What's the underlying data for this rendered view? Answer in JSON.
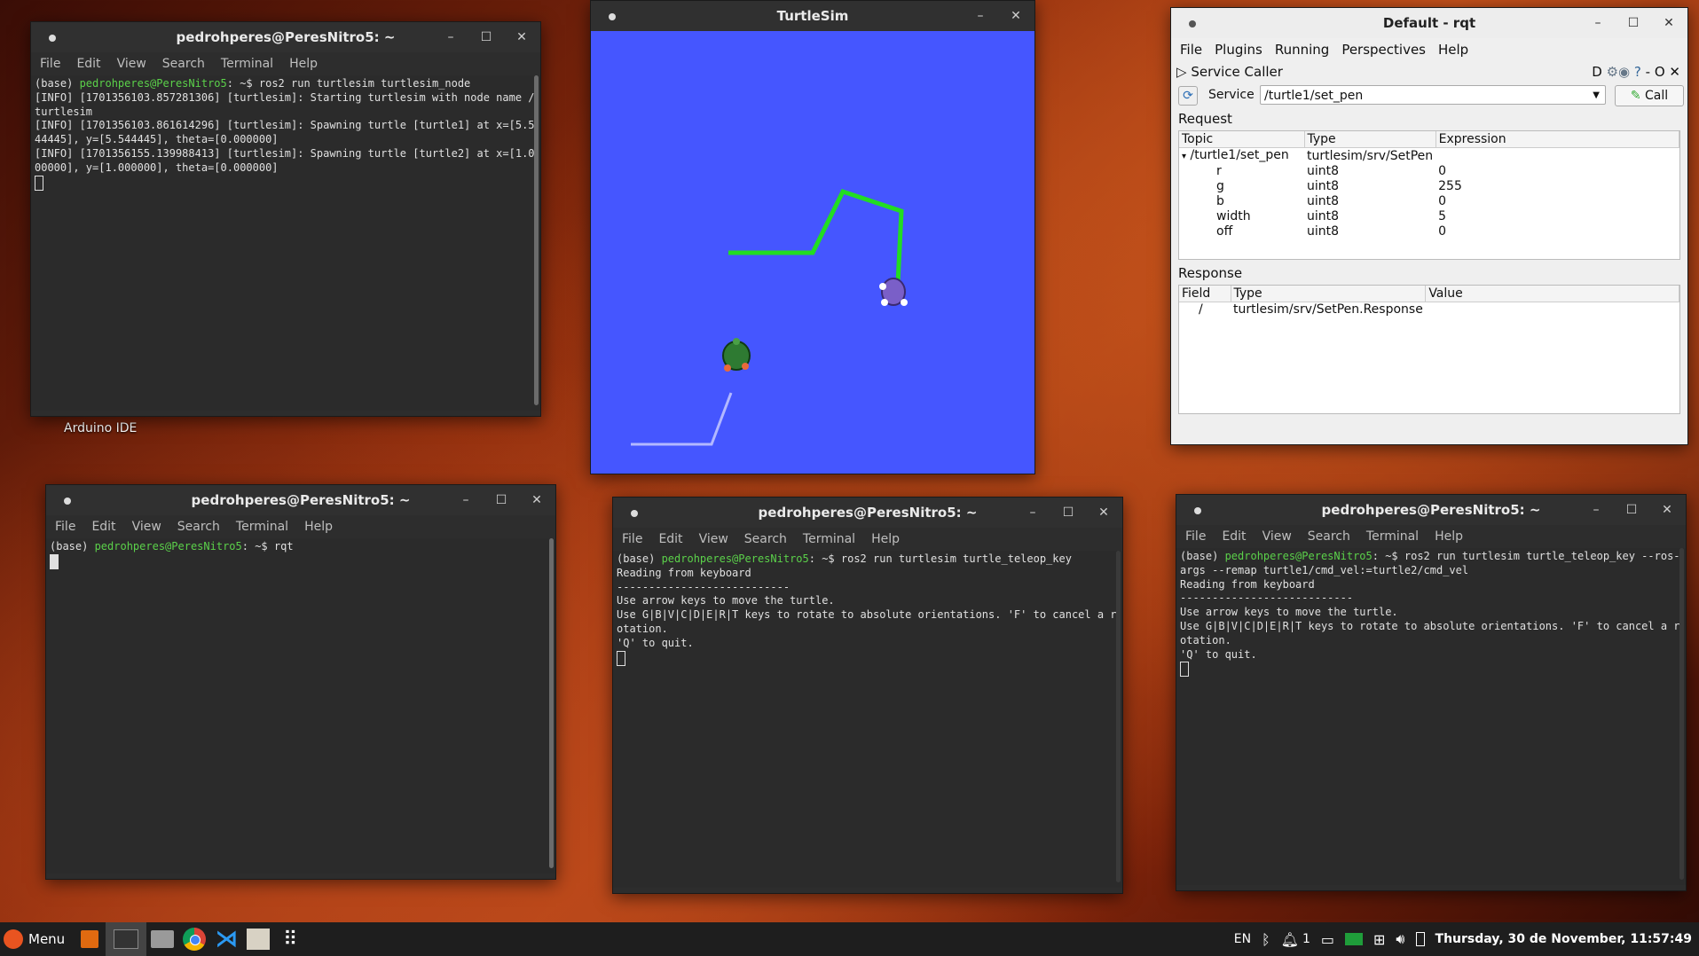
{
  "desktop": {
    "arduino_label": "Arduino IDE"
  },
  "term1": {
    "title": "pedrohperes@PeresNitro5: ~",
    "menu": [
      "File",
      "Edit",
      "View",
      "Search",
      "Terminal",
      "Help"
    ],
    "prompt_env": "(base) ",
    "prompt_user": "pedrohperes@PeresNitro5",
    "prompt_rest": ": ~$ ros2 run turtlesim turtlesim_node",
    "output": "[INFO] [1701356103.857281306] [turtlesim]: Starting turtlesim with node name /turtlesim\n[INFO] [1701356103.861614296] [turtlesim]: Spawning turtle [turtle1] at x=[5.544445], y=[5.544445], theta=[0.000000]\n[INFO] [1701356155.139988413] [turtlesim]: Spawning turtle [turtle2] at x=[1.000000], y=[1.000000], theta=[0.000000]"
  },
  "term2": {
    "title": "pedrohperes@PeresNitro5: ~",
    "menu": [
      "File",
      "Edit",
      "View",
      "Search",
      "Terminal",
      "Help"
    ],
    "prompt_env": "(base) ",
    "prompt_user": "pedrohperes@PeresNitro5",
    "prompt_rest": ": ~$ rqt"
  },
  "term3": {
    "title": "pedrohperes@PeresNitro5: ~",
    "menu": [
      "File",
      "Edit",
      "View",
      "Search",
      "Terminal",
      "Help"
    ],
    "prompt_env": "(base) ",
    "prompt_user": "pedrohperes@PeresNitro5",
    "prompt_rest": ": ~$ ros2 run turtlesim turtle_teleop_key",
    "output": "Reading from keyboard\n---------------------------\nUse arrow keys to move the turtle.\nUse G|B|V|C|D|E|R|T keys to rotate to absolute orientations. 'F' to cancel a rotation.\n'Q' to quit."
  },
  "term4": {
    "title": "pedrohperes@PeresNitro5: ~",
    "menu": [
      "File",
      "Edit",
      "View",
      "Search",
      "Terminal",
      "Help"
    ],
    "prompt_env": "(base) ",
    "prompt_user": "pedrohperes@PeresNitro5",
    "prompt_rest": ": ~$ ros2 run turtlesim turtle_teleop_key --ros-args --remap turtle1/cmd_vel:=turtle2/cmd_vel",
    "output": "Reading from keyboard\n---------------------------\nUse arrow keys to move the turtle.\nUse G|B|V|C|D|E|R|T keys to rotate to absolute orientations. 'F' to cancel a rotation.\n'Q' to quit."
  },
  "turtlesim": {
    "title": "TurtleSim",
    "background": "#4556ff",
    "pen1": "#22dd22",
    "pen2": "#b3b8ff"
  },
  "rqt": {
    "title": "Default - rqt",
    "menu": [
      "File",
      "Plugins",
      "Running",
      "Perspectives",
      "Help"
    ],
    "plugin_name": "Service Caller",
    "plugin_tools": "D",
    "service_label": "Service",
    "service_value": "/turtle1/set_pen",
    "call_label": "Call",
    "request_label": "Request",
    "request_headers": [
      "Topic",
      "Type",
      "Expression"
    ],
    "request_root": {
      "topic": "/turtle1/set_pen",
      "type": "turtlesim/srv/SetPen"
    },
    "request_rows": [
      {
        "topic": "r",
        "type": "uint8",
        "expr": "0"
      },
      {
        "topic": "g",
        "type": "uint8",
        "expr": "255"
      },
      {
        "topic": "b",
        "type": "uint8",
        "expr": "0"
      },
      {
        "topic": "width",
        "type": "uint8",
        "expr": "5"
      },
      {
        "topic": "off",
        "type": "uint8",
        "expr": "0"
      }
    ],
    "response_label": "Response",
    "response_headers": [
      "Field",
      "Type",
      "Value"
    ],
    "response_row": {
      "field": "/",
      "type": "turtlesim/srv/SetPen.Response",
      "value": ""
    }
  },
  "taskbar": {
    "menu_label": "Menu",
    "lang": "EN",
    "notif_count": "1",
    "clock": "Thursday, 30 de November, 11:57:49"
  }
}
